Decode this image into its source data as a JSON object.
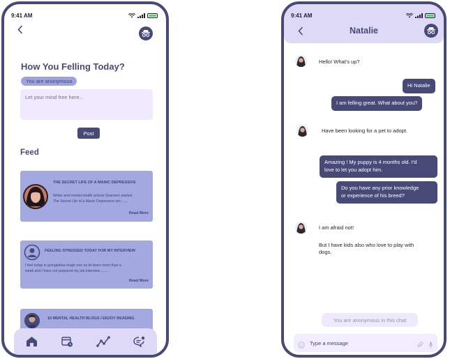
{
  "feed_screen": {
    "status": {
      "time": "9:41 AM"
    },
    "title": "How You Felling Today?",
    "anonymous_badge": "You are anonymous",
    "input_placeholder": "Let your mind free here...",
    "post_label": "Post",
    "feed_title": "Feed",
    "cards": [
      {
        "title": "THE SECRET LIFE OF A MANIC DEPRESSIVE",
        "text_line1": "Writer and mental health activist Seaneen started",
        "text_line2": "The Secret Life of a Manic Depressive ten ......",
        "read_more": "Read More"
      },
      {
        "title": "FEELING STRESSED TODAY FOR MY INTERVIEW",
        "text_line1": "I feel today is goingtobaa tough one as its been more than a",
        "text_line2": "week and I have not prepared my job interview ........",
        "read_more": "Read More"
      },
      {
        "title": "10 MENTAL HEALTH BLOGS I ENJOY READING"
      }
    ]
  },
  "chat_screen": {
    "status": {
      "time": "9:41 AM"
    },
    "contact_name": "Natalie",
    "messages": [
      {
        "side": "received",
        "text": "Hello! What's up?"
      },
      {
        "side": "sent",
        "text": "Hi Natalie"
      },
      {
        "side": "sent",
        "text": "I am felling great. What about you?"
      },
      {
        "side": "received",
        "text": "Have been looking for a pet to adopt."
      },
      {
        "side": "sent",
        "text_line1": "Amazing !  My puppy is 4 months old. I'd",
        "text_line2": "love to let you adopt him."
      },
      {
        "side": "sent",
        "text_line1": "Do you have any prior knowledge",
        "text_line2": "or experience of his breed?"
      },
      {
        "side": "received",
        "text": "I am afraid not!"
      },
      {
        "side": "received",
        "text_line1": "But I have kids also who love to play with",
        "text_line2": "dogs."
      }
    ],
    "anonymous_notice": "You are anonymous in this chat",
    "message_placeholder": "Type a message"
  },
  "colors": {
    "primary": "#474a77",
    "card": "#a3a8e0",
    "header": "#ddd9f7",
    "input_bg": "#efeafe"
  }
}
